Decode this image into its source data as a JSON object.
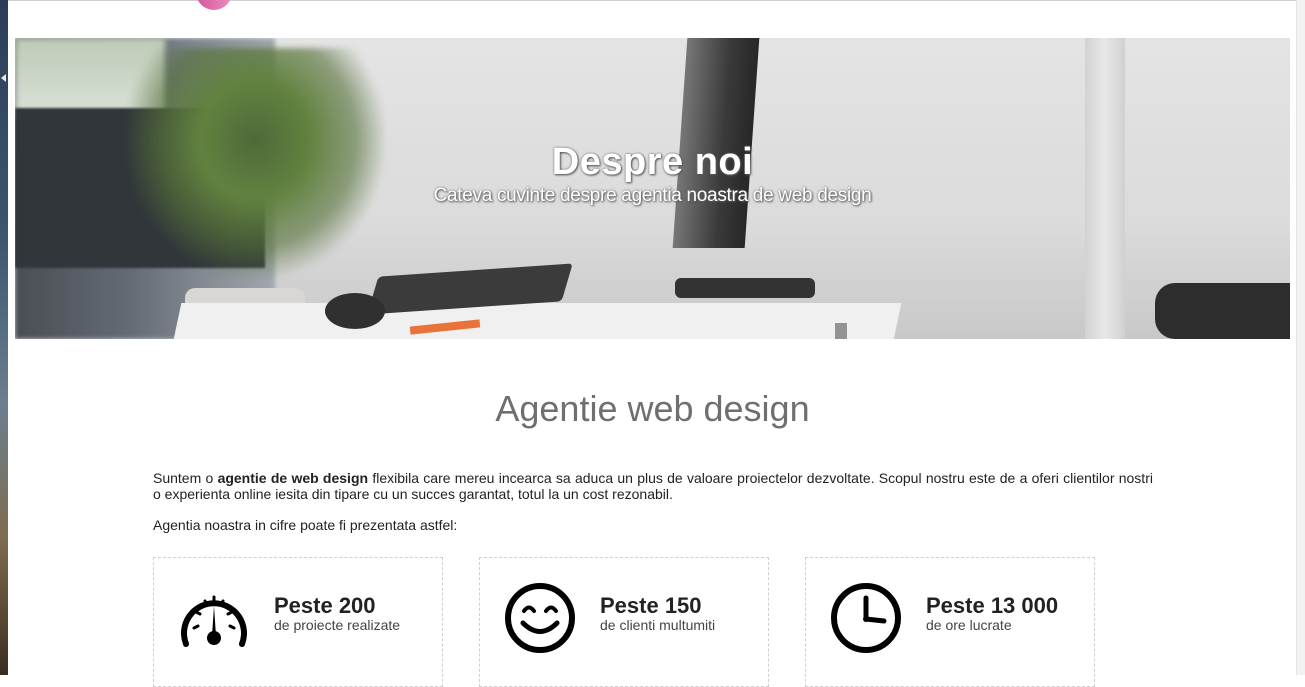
{
  "hero": {
    "title": "Despre noi",
    "subtitle": "Cateva cuvinte despre agentia noastra de web design"
  },
  "section": {
    "title": "Agentie web design",
    "intro_before": "Suntem o ",
    "intro_bold": "agentie de web design",
    "intro_after": " flexibila care mereu incearca sa aduca un plus de valoare proiectelor dezvoltate. Scopul nostru este de a oferi clientilor nostri o experienta online iesita din tipare cu un succes garantat, totul la un cost rezonabil.",
    "lead": "Agentia noastra in cifre poate fi prezentata astfel:"
  },
  "stats": [
    {
      "icon": "speedometer-icon",
      "value": "Peste 200",
      "label": "de proiecte realizate"
    },
    {
      "icon": "smiley-icon",
      "value": "Peste 150",
      "label": "de clienti multumiti"
    },
    {
      "icon": "clock-icon",
      "value": "Peste 13 000",
      "label": "de ore lucrate"
    }
  ],
  "colors": {
    "accent_logo": "#d4559a",
    "heading_gray": "#6f6f6f",
    "text": "#222222",
    "card_border": "#cfcfcf"
  }
}
